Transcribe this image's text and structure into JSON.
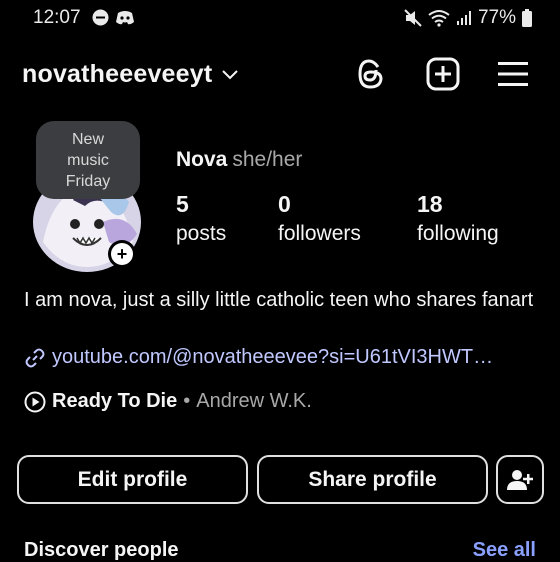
{
  "status_bar": {
    "time": "12:07",
    "battery": "77%"
  },
  "header": {
    "username": "novatheeeveeyt",
    "icons": [
      "threads-icon",
      "create-icon",
      "menu-icon"
    ]
  },
  "profile": {
    "note_bubble": [
      "New",
      "music",
      "Friday"
    ],
    "name": "Nova",
    "pronouns": "she/her",
    "stats": [
      {
        "count": "5",
        "label": "posts"
      },
      {
        "count": "0",
        "label": "followers"
      },
      {
        "count": "18",
        "label": "following"
      }
    ],
    "bio": "I am nova, just a silly little catholic teen who shares fanart",
    "link": "youtube.com/@novatheeevee?si=U61tVI3HWT…",
    "music": {
      "title": "Ready To Die",
      "separator": "•",
      "artist": "Andrew W.K."
    }
  },
  "actions": {
    "edit_profile": "Edit profile",
    "share_profile": "Share profile"
  },
  "discover": {
    "title": "Discover people",
    "see_all": "See all"
  },
  "colors": {
    "background": "#000000",
    "link": "#c0c8ff",
    "see_all": "#8aa0ff",
    "bubble": "#3b3d40"
  }
}
